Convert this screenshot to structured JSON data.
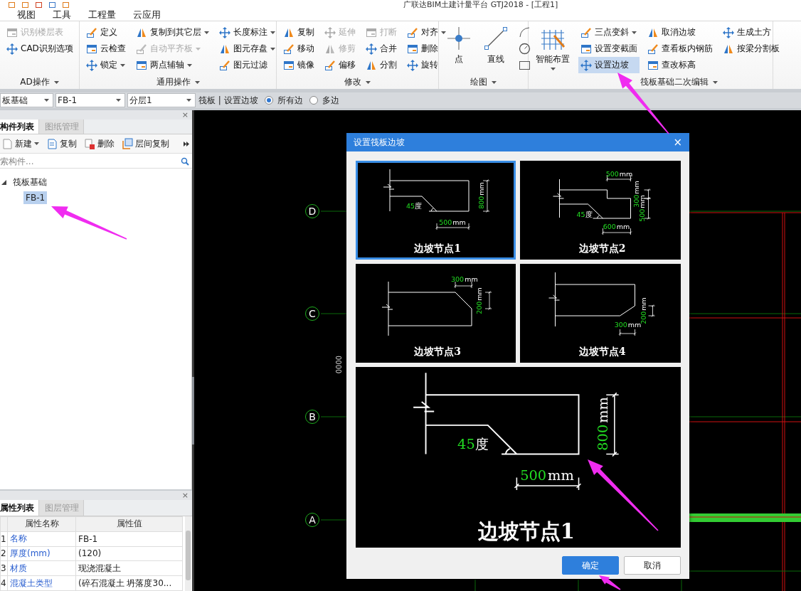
{
  "title_bar": {
    "title": "广联达BIM土建计量平台 GTJ2018 - [工程1]"
  },
  "menu": [
    {
      "label": "视图"
    },
    {
      "label": "工具"
    },
    {
      "label": "工程量"
    },
    {
      "label": "云应用"
    }
  ],
  "ribbon": {
    "groups": [
      {
        "label": "AD操作",
        "columns": [
          [
            {
              "kind": "small",
              "label": "识别楼层表",
              "disabled": true,
              "dropdown": false,
              "selected": false
            },
            {
              "kind": "small",
              "label": "CAD识别选项",
              "disabled": false,
              "dropdown": false,
              "selected": false
            }
          ]
        ]
      },
      {
        "label": "通用操作",
        "columns": [
          [
            {
              "kind": "small",
              "label": "定义",
              "disabled": false,
              "dropdown": false,
              "selected": false
            },
            {
              "kind": "small",
              "label": "云检查",
              "disabled": false,
              "dropdown": false,
              "selected": false
            },
            {
              "kind": "small",
              "label": "锁定",
              "disabled": false,
              "dropdown": true,
              "selected": false
            }
          ],
          [
            {
              "kind": "small",
              "label": "复制到其它层",
              "disabled": false,
              "dropdown": true,
              "selected": false
            },
            {
              "kind": "small",
              "label": "自动平齐板",
              "disabled": true,
              "dropdown": true,
              "selected": false
            },
            {
              "kind": "small",
              "label": "两点辅轴",
              "disabled": false,
              "dropdown": true,
              "selected": false
            }
          ],
          [
            {
              "kind": "small",
              "label": "长度标注",
              "disabled": false,
              "dropdown": true,
              "selected": false
            },
            {
              "kind": "small",
              "label": "图元存盘",
              "disabled": false,
              "dropdown": true,
              "selected": false
            },
            {
              "kind": "small",
              "label": "图元过滤",
              "disabled": false,
              "dropdown": false,
              "selected": false
            }
          ]
        ]
      },
      {
        "label": "修改",
        "columns": [
          [
            {
              "kind": "small",
              "label": "复制",
              "disabled": false,
              "dropdown": false,
              "selected": false
            },
            {
              "kind": "small",
              "label": "移动",
              "disabled": false,
              "dropdown": false,
              "selected": false
            },
            {
              "kind": "small",
              "label": "镜像",
              "disabled": false,
              "dropdown": false,
              "selected": false
            }
          ],
          [
            {
              "kind": "small",
              "label": "延伸",
              "disabled": true,
              "dropdown": false,
              "selected": false
            },
            {
              "kind": "small",
              "label": "修剪",
              "disabled": true,
              "dropdown": false,
              "selected": false
            },
            {
              "kind": "small",
              "label": "偏移",
              "disabled": false,
              "dropdown": false,
              "selected": false
            }
          ],
          [
            {
              "kind": "small",
              "label": "打断",
              "disabled": true,
              "dropdown": false,
              "selected": false
            },
            {
              "kind": "small",
              "label": "合并",
              "disabled": false,
              "dropdown": false,
              "selected": false
            },
            {
              "kind": "small",
              "label": "分割",
              "disabled": false,
              "dropdown": false,
              "selected": false
            }
          ],
          [
            {
              "kind": "small",
              "label": "对齐",
              "disabled": false,
              "dropdown": true,
              "selected": false
            },
            {
              "kind": "small",
              "label": "删除",
              "disabled": false,
              "dropdown": false,
              "selected": false
            },
            {
              "kind": "small",
              "label": "旋转",
              "disabled": false,
              "dropdown": false,
              "selected": false
            }
          ]
        ]
      },
      {
        "label": "绘图",
        "columns": [
          [
            {
              "kind": "large",
              "label": "点",
              "disabled": false,
              "dropdown": false,
              "selected": false
            }
          ],
          [
            {
              "kind": "large",
              "label": "直线",
              "disabled": false,
              "dropdown": false,
              "selected": false
            }
          ],
          [
            {
              "kind": "icon",
              "disabled": false,
              "dropdown": false,
              "selected": false
            },
            {
              "kind": "icon",
              "disabled": false,
              "dropdown": false,
              "selected": false
            },
            {
              "kind": "icon",
              "disabled": false,
              "dropdown": false,
              "selected": false
            }
          ]
        ]
      },
      {
        "label": "筏板基础二次编辑",
        "columns": [
          [
            {
              "kind": "large",
              "label": "智能布置",
              "disabled": false,
              "dropdown": true,
              "selected": false
            }
          ],
          [
            {
              "kind": "small",
              "label": "三点变斜",
              "disabled": false,
              "dropdown": true,
              "selected": false
            },
            {
              "kind": "small",
              "label": "设置变截面",
              "disabled": false,
              "dropdown": false,
              "selected": false
            },
            {
              "kind": "small",
              "label": "设置边坡",
              "disabled": false,
              "dropdown": false,
              "selected": true
            }
          ],
          [
            {
              "kind": "small",
              "label": "取消边坡",
              "disabled": false,
              "dropdown": false,
              "selected": false
            },
            {
              "kind": "small",
              "label": "查看板内钢筋",
              "disabled": false,
              "dropdown": false,
              "selected": false
            },
            {
              "kind": "small",
              "label": "查改标高",
              "disabled": false,
              "dropdown": false,
              "selected": false
            }
          ],
          [
            {
              "kind": "small",
              "label": "生成土方",
              "disabled": false,
              "dropdown": false,
              "selected": false
            },
            {
              "kind": "small",
              "label": "按梁分割板",
              "disabled": false,
              "dropdown": false,
              "selected": false
            }
          ]
        ]
      }
    ]
  },
  "option_bar": {
    "combos": [
      {
        "value": "板基础"
      },
      {
        "value": "FB-1"
      },
      {
        "value": "分层1"
      }
    ],
    "status": "筏板 | 设置边坡",
    "radios": [
      {
        "label": "所有边",
        "selected": true
      },
      {
        "label": "多边",
        "selected": false
      }
    ]
  },
  "component_panel": {
    "close": "×",
    "tabs": [
      {
        "label": "构件列表",
        "selected": true
      },
      {
        "label": "图纸管理",
        "selected": false
      }
    ],
    "actions": [
      {
        "label": "新建",
        "dropdown": true
      },
      {
        "label": "复制",
        "dropdown": false
      },
      {
        "label": "删除",
        "dropdown": false
      },
      {
        "label": "层间复制",
        "dropdown": false
      }
    ],
    "search": {
      "placeholder": "索构件..."
    },
    "tree": [
      {
        "label": "筏板基础",
        "expanded": true,
        "selected": false,
        "children": [
          {
            "label": "FB-1",
            "selected": true
          }
        ]
      }
    ]
  },
  "property_panel": {
    "close": "×",
    "tabs": [
      {
        "label": "属性列表",
        "selected": true
      },
      {
        "label": "图层管理",
        "selected": false
      }
    ],
    "columns": [
      "属性名称",
      "属性值"
    ],
    "rows": [
      {
        "index": "1",
        "name": "名称",
        "value": "FB-1"
      },
      {
        "index": "2",
        "name": "厚度(mm)",
        "value": "(120)"
      },
      {
        "index": "3",
        "name": "材质",
        "value": "现浇混凝土"
      },
      {
        "index": "4",
        "name": "混凝土类型",
        "value": "(碎石混凝土 坍落度30..."
      }
    ]
  },
  "canvas": {
    "axes": [
      {
        "label": "D"
      },
      {
        "label": "C"
      },
      {
        "label": "B"
      },
      {
        "label": "A"
      }
    ],
    "side_label": "0000"
  },
  "dialog": {
    "title": "设置筏板边坡",
    "close": "×",
    "options": [
      {
        "kind": "slope-bottom",
        "title": "边坡节点1",
        "selected": true,
        "angle": {
          "value": "45",
          "unit": "度"
        },
        "dims": [
          {
            "value": "800",
            "unit": "mm"
          },
          {
            "value": "500",
            "unit": "mm"
          }
        ]
      },
      {
        "kind": "step-slope",
        "title": "边坡节点2",
        "selected": false,
        "angle": {
          "value": "45",
          "unit": "度"
        },
        "dims": [
          {
            "value": "500",
            "unit": "mm"
          },
          {
            "value": "300",
            "unit": "mm"
          },
          {
            "value": "500",
            "unit": "mm"
          },
          {
            "value": "600",
            "unit": "mm"
          }
        ]
      },
      {
        "kind": "top-chamfer",
        "title": "边坡节点3",
        "selected": false,
        "dims": [
          {
            "value": "300",
            "unit": "mm"
          },
          {
            "value": "200",
            "unit": "mm"
          }
        ]
      },
      {
        "kind": "bottom-chamfer",
        "title": "边坡节点4",
        "selected": false,
        "dims": [
          {
            "value": "200",
            "unit": "mm"
          },
          {
            "value": "300",
            "unit": "mm"
          }
        ]
      }
    ],
    "preview": {
      "kind": "slope-bottom",
      "title": "边坡节点1",
      "angle": {
        "value": "45",
        "unit": "度"
      },
      "dims": [
        {
          "value": "800",
          "unit": "mm"
        },
        {
          "value": "500",
          "unit": "mm"
        }
      ]
    },
    "buttons": [
      {
        "label": "确定",
        "kind": "primary"
      },
      {
        "label": "取消",
        "kind": "secondary"
      }
    ]
  }
}
